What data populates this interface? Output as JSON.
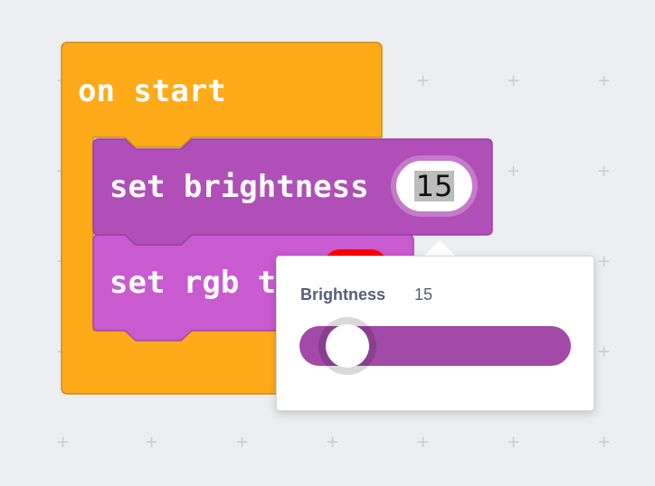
{
  "blocks": {
    "on_start": {
      "label": "on start",
      "color": "#ffab19",
      "border": "#cf8b17"
    },
    "set_brightness": {
      "label": "set brightness",
      "value": "15",
      "color": "#b04fb8",
      "border": "#9a3fa2"
    },
    "set_rgb": {
      "label": "set rgb t",
      "color": "#c95bd0",
      "border": "#a648ac",
      "swatch_color": "#ff0000"
    }
  },
  "popup": {
    "label": "Brightness",
    "value": "15",
    "slider": {
      "min": 0,
      "max": 255,
      "value": 15
    },
    "track_color": "#a349a8"
  }
}
